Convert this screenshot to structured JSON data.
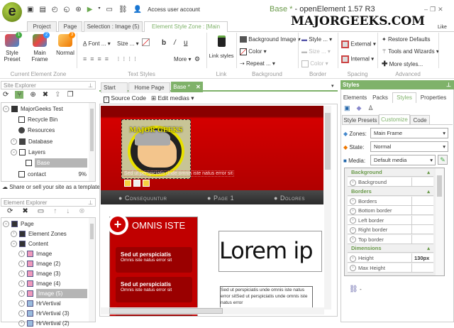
{
  "app": {
    "title_doc": "Base *",
    "title_rest": " - openElement 1.57 R3",
    "account": "Access user account",
    "watermark": "MAJORGEEKS.COM",
    "like": "Like"
  },
  "ribbon_tabs": [
    "Project",
    "Page",
    "Selection : Image (5)",
    "Element Style Zone : [Main Frame]"
  ],
  "zone_group": {
    "buttons": [
      "Style Preset",
      "Main Frame",
      "Normal"
    ],
    "badges": [
      "1",
      "2",
      "3"
    ],
    "label": "Current Element Zone"
  },
  "text_styles": {
    "font": "Font ...",
    "size": "Size ...",
    "more": "More",
    "label": "Text Styles"
  },
  "link": {
    "button": "Link styles",
    "label": "Link"
  },
  "background": {
    "items": [
      "Background Image",
      "Color",
      "Repeat ..."
    ],
    "label": "Background"
  },
  "border": {
    "items": [
      "Style ...",
      "Size ...",
      "Color"
    ],
    "label": "Border"
  },
  "spacing": {
    "items": [
      "External",
      "Internal"
    ],
    "label": "Spacing"
  },
  "advanced": {
    "items": [
      "Restore Defaults",
      "Tools and Wizards",
      "More styles..."
    ],
    "label": "Advanced"
  },
  "site_explorer": {
    "title": "Site Explorer",
    "items": [
      {
        "label": "MajorGeeks Test"
      },
      {
        "label": "Recycle Bin"
      },
      {
        "label": "Resources"
      },
      {
        "label": "Database"
      },
      {
        "label": "Layers"
      },
      {
        "label": "Base"
      },
      {
        "label": "contact",
        "pct": "9%"
      }
    ],
    "share": "Share or sell your site as a template"
  },
  "element_explorer": {
    "title": "Element Explorer",
    "items": [
      "Page",
      "Element Zones",
      "Content",
      "Image",
      "Image (2)",
      "Image (3)",
      "Image (4)",
      "Image (5)",
      "HrVertival",
      "HrVertival (3)",
      "HrVertival (2)"
    ]
  },
  "doc_tabs": [
    "Start",
    "Home Page",
    "Base *"
  ],
  "doc_toolbar": {
    "source": "Source Code",
    "medias": "Edit medias"
  },
  "canvas": {
    "logo_text": "MAJOR GEEKS",
    "caption": "Sed ut perspiciatis unde omnis iste natus error sit",
    "nav": [
      "Consequuntur",
      "Page 1",
      "Dolores"
    ],
    "box_title": "OMNIS ISTE",
    "cards": [
      {
        "title": "Sed ut perspiciatis",
        "sub": "Omnis iste natus error sit"
      },
      {
        "title": "Sed ut perspiciatis",
        "sub": "Omnis iste natus error sit"
      }
    ],
    "big": "Lorem ip",
    "para": "Sed ut perspiciatis unde omnis iste natus error sitSed ut perspiciatis unde omnis iste natus error"
  },
  "styles": {
    "title": "Styles",
    "tabs": [
      "Elements",
      "Packs",
      "Styles",
      "Properties"
    ],
    "subtabs": [
      "Style Presets",
      "Customize",
      "Code"
    ],
    "zones_label": "Zones:",
    "zones": "Main Frame",
    "state_label": "State:",
    "state": "Normal",
    "media_label": "Media:",
    "media": "Default media",
    "grid": [
      {
        "cat": "Background",
        "rows": [
          {
            "n": "Background",
            "v": ""
          }
        ]
      },
      {
        "cat": "Borders",
        "rows": [
          {
            "n": "Borders",
            "v": ""
          },
          {
            "n": "Bottom border",
            "v": ""
          },
          {
            "n": "Left border",
            "v": ""
          },
          {
            "n": "Right border",
            "v": ""
          },
          {
            "n": "Top border",
            "v": ""
          }
        ]
      },
      {
        "cat": "Dimensions",
        "rows": [
          {
            "n": "Height",
            "v": "130px"
          },
          {
            "n": "Max Height",
            "v": ""
          }
        ]
      }
    ],
    "footer": "-"
  },
  "colors": {
    "accent": "#7fb26a",
    "red": "#c00000",
    "navbar": "#3a3a3a"
  }
}
